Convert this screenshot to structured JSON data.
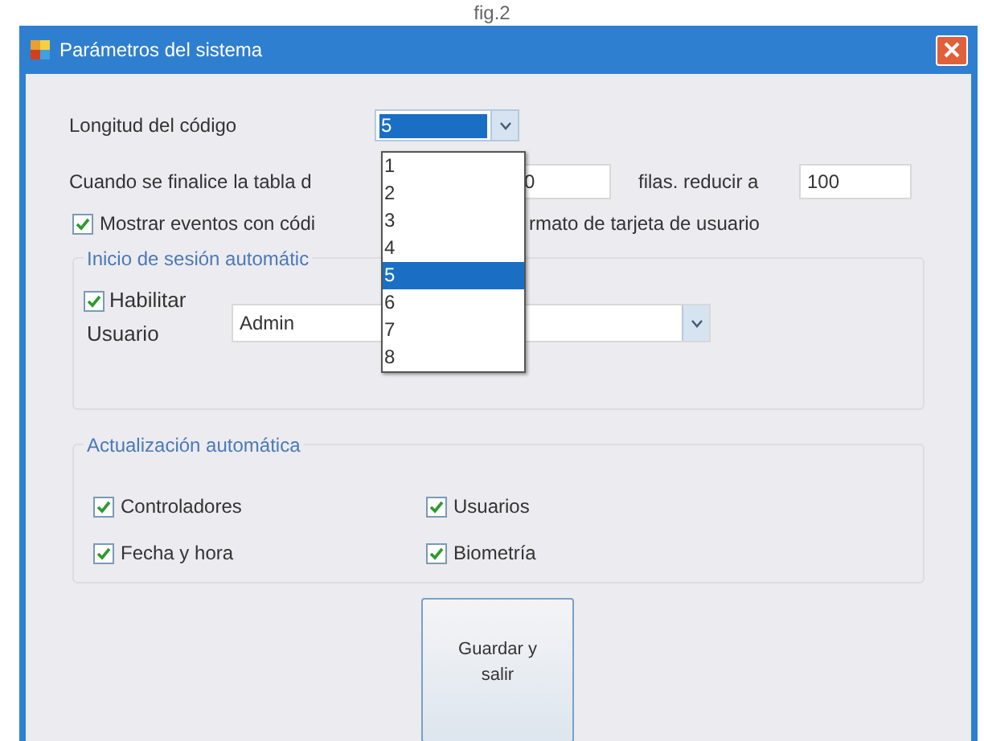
{
  "caption": "fig.2",
  "window": {
    "title": "Parámetros del sistema"
  },
  "code_length": {
    "label": "Longitud del código",
    "value": "5",
    "options": [
      {
        "label": "1",
        "selected": false
      },
      {
        "label": "2",
        "selected": false
      },
      {
        "label": "3",
        "selected": false
      },
      {
        "label": "4",
        "selected": false
      },
      {
        "label": "5",
        "selected": true
      },
      {
        "label": "6",
        "selected": false
      },
      {
        "label": "7",
        "selected": false
      },
      {
        "label": "8",
        "selected": false
      }
    ]
  },
  "table_limit": {
    "label": "Cuando se finalice la tabla d",
    "value": "0",
    "reduce_label": "filas. reducir a",
    "reduce_value": "100"
  },
  "show_events": {
    "label_start": "Mostrar eventos con códi",
    "label_end": "rmato de tarjeta de usuario",
    "checked": true
  },
  "auto_login": {
    "title": "Inicio de sesión automátic",
    "enable": {
      "label": "Habilitar",
      "checked": true
    },
    "user_label": "Usuario",
    "user_value": "Admin"
  },
  "auto_update": {
    "title": "Actualización automática",
    "items": [
      {
        "label": "Controladores",
        "checked": true
      },
      {
        "label": "Usuarios",
        "checked": true
      },
      {
        "label": "Fecha y hora",
        "checked": true
      },
      {
        "label": "Biometría",
        "checked": true
      }
    ]
  },
  "save_button": "Guardar y salir"
}
